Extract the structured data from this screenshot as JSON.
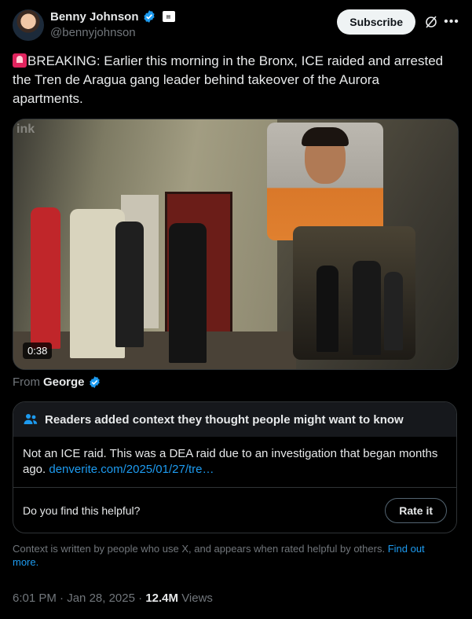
{
  "author": {
    "name": "Benny Johnson",
    "handle": "@bennyjohnson",
    "verified_icon": "verified-badge-icon",
    "affiliation_icon": "affiliation-badge-icon"
  },
  "header": {
    "subscribe_label": "Subscribe",
    "grok_icon": "grok-icon",
    "more_icon": "more-icon"
  },
  "tweet": {
    "emoji": "police-light-emoji",
    "text": "BREAKING: Earlier this morning in the Bronx, ICE raided and arrested the Tren de Aragua gang leader behind takeover of the Aurora apartments."
  },
  "media": {
    "duration": "0:38",
    "watermark": "ink"
  },
  "source": {
    "prefix": "From",
    "name": "George"
  },
  "community_note": {
    "heading": "Readers added context they thought people might want to know",
    "body": "Not an ICE raid. This was a DEA raid due to an investigation that began months ago.",
    "link": "denverite.com/2025/01/27/tre…",
    "question": "Do you find this helpful?",
    "rate_label": "Rate it"
  },
  "context_disclaimer": {
    "text": "Context is written by people who use X, and appears when rated helpful by others.",
    "link": "Find out more."
  },
  "meta": {
    "time": "6:01 PM",
    "sep1": "·",
    "date": "Jan 28, 2025",
    "sep2": "·",
    "views_count": "12.4M",
    "views_label": "Views"
  },
  "colors": {
    "background": "#000000",
    "text": "#e7e9ea",
    "secondary": "#71767b",
    "link": "#1d9bf0",
    "verified": "#1d9bf0"
  }
}
